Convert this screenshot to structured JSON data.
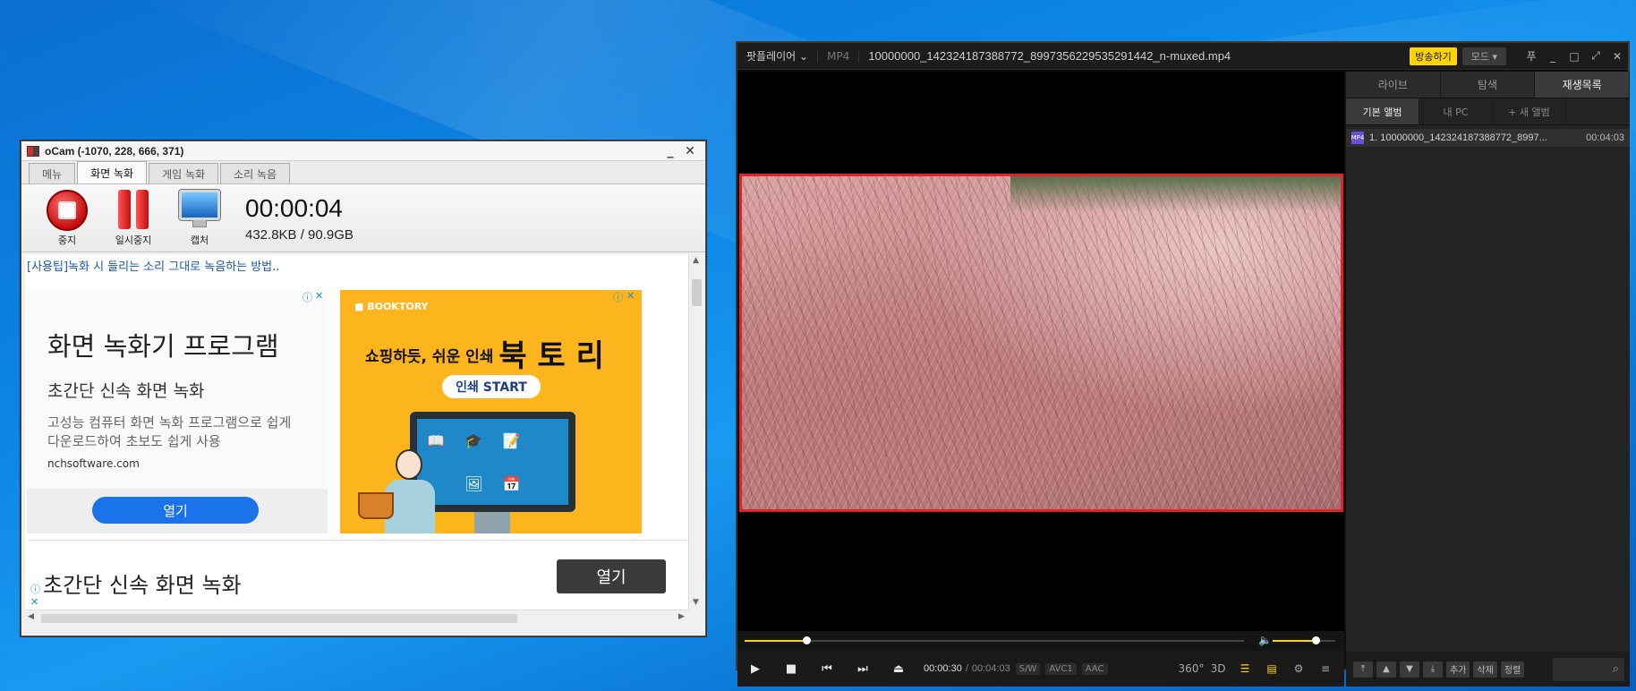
{
  "ocam": {
    "title": "oCam (-1070, 228, 666, 371)",
    "min": "_",
    "close": "✕",
    "tabs": [
      "메뉴",
      "화면 녹화",
      "게임 녹화",
      "소리 녹음"
    ],
    "tools": {
      "stop": "중지",
      "pause": "일시중지",
      "capture": "캡처"
    },
    "time": "00:00:04",
    "size": "432.8KB / 90.9GB",
    "tip_link": "[사용팁]녹화 시 들리는 소리 그대로 녹음하는 방법..",
    "ad_left": {
      "headline": "화면 녹화기 프로그램",
      "sub": "초간단 신속 화면 녹화",
      "desc": "고성능 컴퓨터 화면 녹화 프로그램으로 쉽게 다운로드하여 초보도 쉽게 사용",
      "domain": "nchsoftware.com",
      "open": "열기"
    },
    "ad_right": {
      "brand": "■ BOOKTORY",
      "slogan": "쇼핑하듯, 쉬운 인쇄",
      "brand_big": "북 토 리",
      "cta": "인쇄 START"
    },
    "ad_bottom": {
      "text": "초간단 신속 화면 녹화",
      "open": "열기"
    }
  },
  "potplayer": {
    "menu": "팟플레이어",
    "menu_caret": "⌄",
    "format": "MP4",
    "filename": "10000000_142324187388772_8997356229535291442_n-muxed.mp4",
    "broadcast": "방송하기",
    "mode": "모드",
    "mode_caret": "▾",
    "pin": "푸",
    "time_current": "00:00:30",
    "time_sep": "/",
    "time_total": "00:04:03",
    "tags": [
      "S/W",
      "AVC1",
      "AAC"
    ],
    "progress_fraction": 0.123,
    "volume_fraction": 0.68,
    "label_360": "360°",
    "label_3d": "3D",
    "side_tabs": [
      "라이브",
      "탐색",
      "재생목록"
    ],
    "side_sub": [
      "기본 앨범",
      "내 PC",
      "+ 새 앨범"
    ],
    "playlist": [
      {
        "name": "1. 10000000_142324187388772_8997...",
        "duration": "00:04:03",
        "icon": "MP4"
      }
    ],
    "footer_buttons": [
      "추가",
      "삭제",
      "정렬"
    ]
  },
  "colors": {
    "accent": "#ffd400",
    "frame_border": "#e0232b",
    "ad_yellow": "#fcb51d",
    "ad_blue_btn": "#1a73e8"
  }
}
